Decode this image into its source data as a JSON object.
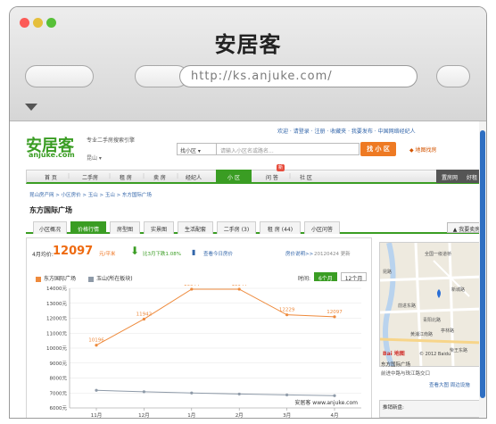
{
  "window": {
    "title": "安居客",
    "url": "http://ks.anjuke.com/"
  },
  "site": {
    "top_links": "欢迎 · 请登录 · 注册 · 收藏夹 · 我要发布 ·  中国网络经纪人",
    "logo_cn": "安居客",
    "logo_en": "anjuke.com",
    "slogan": "专业二手房搜索引擎",
    "city": "昆山 ▾",
    "search": {
      "scope": "找小区 ▾",
      "placeholder": "请输入小区名或路名...",
      "button": "找 小 区"
    },
    "map_search": "◆ 地图找房"
  },
  "nav": {
    "items": [
      "首 页",
      "二手房",
      "租 房",
      "卖 房",
      "经纪人",
      "小 区",
      "问 答",
      "社 区"
    ],
    "active": "小 区",
    "badge": "新",
    "right": [
      "置房网",
      "好租"
    ]
  },
  "breadcrumb": "昆山房产网 > 小区房价 > 玉山 > 玉山 > 东方国际广场",
  "community_title": "东方国际广场",
  "tabs": {
    "items": [
      "小区概况",
      "价格行情",
      "房型图",
      "实景图",
      "生活配套",
      "二手房 (3)",
      "租 房 (44)",
      "小区问答"
    ],
    "active": "价格行情",
    "right": "▲ 我要卖房"
  },
  "price": {
    "label": "4月均价:",
    "value": "12097",
    "unit": "元/平米",
    "compare": "比3月下跌1.08%",
    "today_link": "查看今日房价",
    "info_link": "房价说明>>",
    "date": "20120424 更新"
  },
  "legend": {
    "series1": "东方国际广场",
    "series2": "玉山(所在板块)",
    "period_label": "时间:",
    "period_options": [
      "6个月",
      "12个月"
    ],
    "period_active": "6个月"
  },
  "colors": {
    "green": "#3a9d23",
    "orange": "#ee8a3c",
    "gray": "#8e9aa8",
    "link": "#3366aa"
  },
  "chart_data": {
    "type": "line",
    "x": [
      "11月",
      "12月",
      "1月",
      "2月",
      "3月",
      "4月"
    ],
    "series": [
      {
        "name": "东方国际广场",
        "values": [
          10196,
          11942,
          13944,
          13944,
          12229,
          12097
        ]
      },
      {
        "name": "玉山(所在板块)",
        "values": [
          7180,
          7080,
          7000,
          6930,
          6870,
          6820
        ]
      }
    ],
    "yticks": [
      "14000元",
      "13000元",
      "12000元",
      "11000元",
      "10000元",
      "9000元",
      "8000元",
      "7000元",
      "6000元"
    ],
    "ylim": [
      6000,
      14000
    ],
    "data_labels": [
      "10196",
      "11942",
      "13944",
      "13944",
      "12229",
      "12097"
    ],
    "watermark": "安居客 www.anjuke.com",
    "grid": true
  },
  "sidebar": {
    "map_labels": [
      "全国一级道桥",
      "昆路",
      "前进东路",
      "青阳北路",
      "亭林路",
      "黄浦江南路",
      "柴王东路",
      "新城路"
    ],
    "map_brand": "Bai 地图",
    "map_copyright": "© 2012 Baidu",
    "name": "东方国际广场",
    "address": "前进中路与珠江路交口",
    "links": "查看大图  周边设施",
    "box_title": "推销新盘:"
  }
}
